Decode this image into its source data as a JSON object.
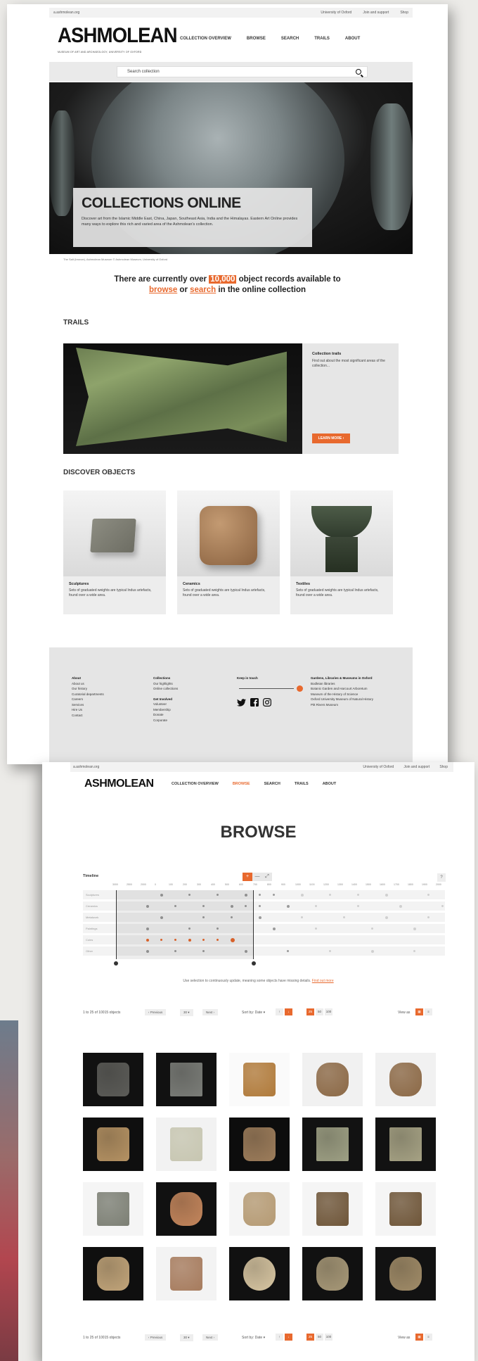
{
  "card1": {
    "utility_left": "a.ashmolean.org",
    "utility_right": [
      "University of Oxford",
      "Join and support",
      "Shop"
    ],
    "logo": "ASHMOLEAN",
    "logo_sub": "MUSEUM OF ART AND ARCHAEOLOGY, UNIVERSITY OF OXFORD",
    "nav": [
      "COLLECTION OVERVIEW",
      "BROWSE",
      "SEARCH",
      "TRAILS",
      "ABOUT"
    ],
    "search_placeholder": "Search collection",
    "hero_title": "COLLECTIONS ONLINE",
    "hero_text": "Discover art from the Islamic Middle East, China, Japan, Southeast Asia, India and the Himalayas. Eastern Art Online provides many ways to explore this rich and varied area of the Ashmolean's collection.",
    "hero_caption": "The Salt (bronze), Ashmolean Museum © Ashmolean Museum, University of Oxford",
    "stat_pre": "There are currently over ",
    "stat_num": "10,000",
    "stat_post": " object records available to",
    "stat_browse": "browse",
    "stat_or": " or ",
    "stat_search": "search",
    "stat_end": " in the online collection",
    "trails_heading": "TRAILS",
    "trail_panel_title": "Collection trails",
    "trail_panel_text": "Find out about the most significant areas of the collection...",
    "learn_more": "LEARN MORE  ›",
    "discover_heading": "DISCOVER OBJECTS",
    "objects": [
      {
        "name": "Sculptures",
        "desc": "Sets of graduated weights are typical Indus artefacts, found over a wide area."
      },
      {
        "name": "Ceramics",
        "desc": "Sets of graduated weights are typical Indus artefacts, found over a wide area."
      },
      {
        "name": "Textiles",
        "desc": "Sets of graduated weights are typical Indus artefacts, found over a wide area."
      }
    ],
    "footer": {
      "col1_title": "About",
      "col1": [
        "About us",
        "Our history",
        "Curatorial departments",
        "Careers",
        "Services",
        "Hire Us",
        "Contact"
      ],
      "col2_title": "Collections",
      "col2": [
        "Our highlights",
        "Online collections"
      ],
      "col2b_title": "Get Involved",
      "col2b": [
        "Volunteer",
        "Membership",
        "Donate",
        "Corporate"
      ],
      "col3_title": "Keep in touch",
      "col4_title": "Gardens, Libraries & Museums in Oxford",
      "col4": [
        "Bodleian libraries",
        "Botanic Garden and Harcourt Arboretum",
        "Museum of the History of Science",
        "Oxford University Museum of Natural History",
        "Pitt Rivers Museum"
      ]
    }
  },
  "card2": {
    "utility_left": "a.ashmolean.org",
    "utility_right": [
      "University of Oxford",
      "Join and support",
      "Shop"
    ],
    "logo": "ASHMOLEAN",
    "nav": [
      "COLLECTION OVERVIEW",
      "BROWSE",
      "SEARCH",
      "TRAILS",
      "ABOUT"
    ],
    "browse_title": "BROWSE",
    "timeline_label": "Timeline",
    "timeline_controls": [
      "+",
      "—",
      "⤢"
    ],
    "timeline_ticks": [
      "3000",
      "2500",
      "2000",
      "0",
      "100",
      "200",
      "300",
      "400",
      "500",
      "600",
      "700",
      "800",
      "900",
      "1000",
      "1100",
      "1200",
      "1300",
      "1400",
      "1500",
      "1600",
      "1700",
      "1800",
      "1900",
      "2000"
    ],
    "timeline_rows": [
      "Sculptures",
      "Ceramics",
      "Metalwork",
      "Paintings",
      "Coins",
      "Other"
    ],
    "timeline_note": "Use selection to continuously update, meaning some objects have missing details.",
    "timeline_note_link": "Find out more",
    "results_text": "1 to 25 of 10015 objects",
    "prev": "‹ Previous",
    "per_page": "30 ▾",
    "next": "Next ›",
    "sort": "Sort by: Date ▾",
    "page_sizes": [
      "25",
      "50",
      "100"
    ],
    "view_as": "View as"
  },
  "colors": {
    "accent": "#e8692e",
    "footer_bg": "#e5e5e5"
  }
}
